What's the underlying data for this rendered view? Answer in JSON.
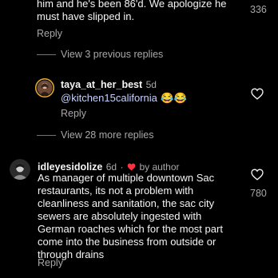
{
  "comments": {
    "top_partial": {
      "text": "him and he's been 86'd. We apologize he\nmust have slipped in.",
      "like_count": "336",
      "reply_label": "Reply"
    },
    "view_previous_replies": "View 3 previous replies",
    "reply_taya": {
      "username": "taya_at_her_best",
      "age": "5d",
      "mention": "@kitchen15california",
      "emoji": "😂😂",
      "reply_label": "Reply"
    },
    "view_more_replies": "View 28 more replies",
    "comment_idle": {
      "username": "idleyesidolize",
      "age": "6d",
      "separator": "·",
      "liked_by_author": "by author",
      "text": "As manager of multiple downtown Sac\nrestaurants,  its not a problem with\ncleanliness and sanitation, the sac city\nsewers are absolutely ingested with\nGerman roaches which for the most part\ncome into the business from outside or\nthrough drains",
      "like_count": "780",
      "reply_label": "Reply"
    }
  },
  "icons": {
    "heart": "heart-icon",
    "author_heart": "red-heart-icon"
  },
  "colors": {
    "background": "#000000",
    "text": "#f5f5f5",
    "muted": "#a8a8a8",
    "author_heart": "#ff3040",
    "mention": "#c7d2ff"
  }
}
